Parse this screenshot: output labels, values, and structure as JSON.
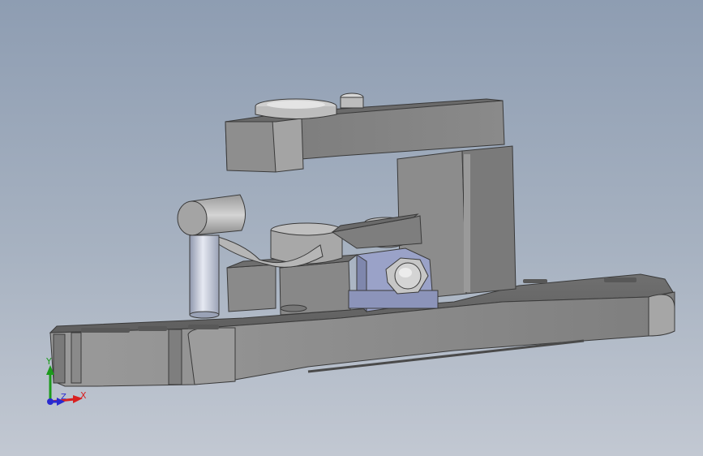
{
  "viewport": {
    "background_top": "#8e9db2",
    "background_bottom": "#c2c8d2",
    "model_color": "#8a8a8a",
    "accent_color": "#9aa2c8"
  },
  "triad": {
    "x_label": "X",
    "y_label": "Y",
    "z_label": "Z",
    "x_color": "#d82020",
    "y_color": "#1c9a1c",
    "z_color": "#2a2ad0"
  }
}
